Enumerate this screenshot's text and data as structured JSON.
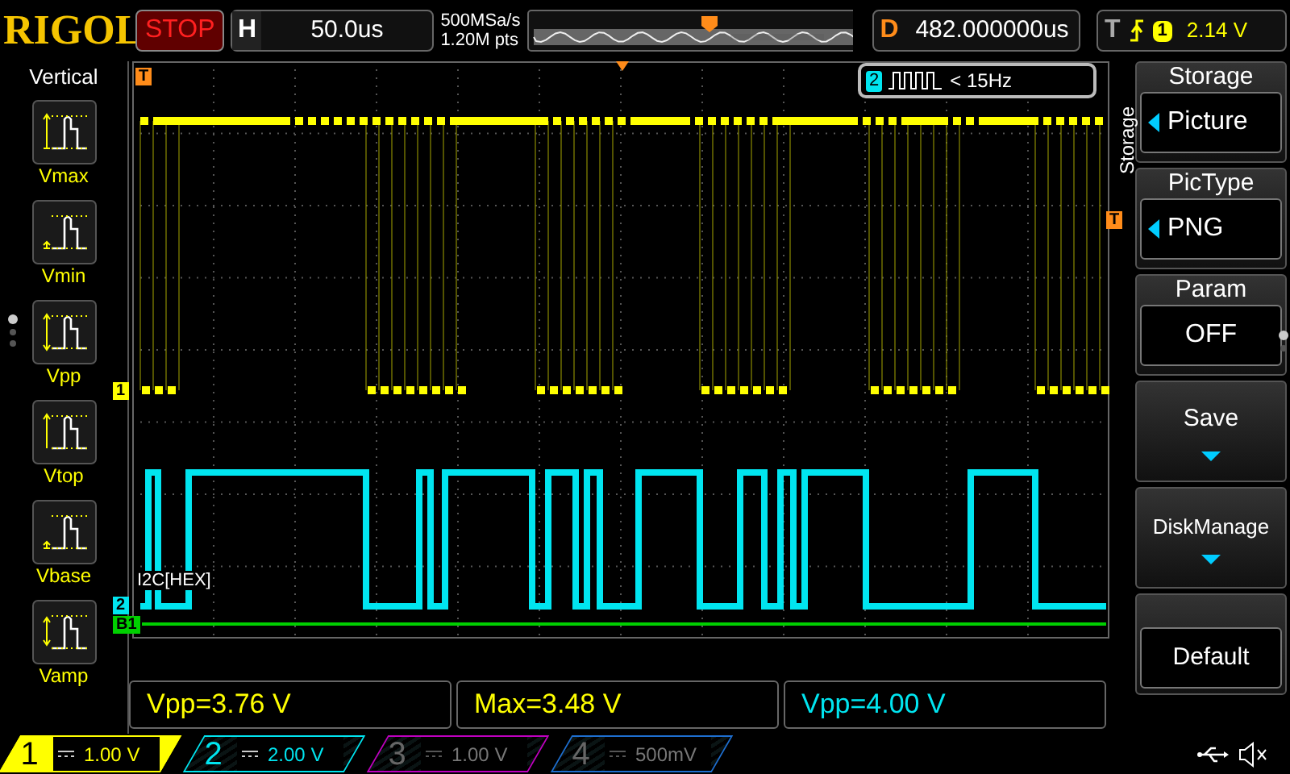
{
  "header": {
    "brand": "RIGOL",
    "run_state": "STOP",
    "horizontal": {
      "label": "H",
      "value": "50.0us"
    },
    "sample_rate": "500MSa/s",
    "memory_depth": "1.20M pts",
    "delay": {
      "label": "D",
      "value": "482.000000us"
    },
    "trigger": {
      "label": "T",
      "source": "1",
      "level": "2.14 V"
    }
  },
  "left_panel": {
    "title": "Vertical",
    "items": [
      {
        "label": "Vmax"
      },
      {
        "label": "Vmin"
      },
      {
        "label": "Vpp"
      },
      {
        "label": "Vtop"
      },
      {
        "label": "Vbase"
      },
      {
        "label": "Vamp"
      }
    ],
    "pages": [
      {
        "selected": true
      },
      {
        "selected": false
      },
      {
        "selected": false
      }
    ]
  },
  "screen": {
    "counter": {
      "channel": "2",
      "reading": "< 15Hz"
    },
    "trigger_marker": "T",
    "trigger_level_marker": "T",
    "channel_markers": [
      {
        "label": "1",
        "color": "#ffff00"
      },
      {
        "label": "2",
        "color": "#00e5f0"
      },
      {
        "label": "B1",
        "color": "#00d000"
      }
    ],
    "bus_label": "I2C[HEX]"
  },
  "right_menu": {
    "title": "Storage",
    "items": [
      {
        "kind": "select",
        "title": "Storage",
        "value": "Picture"
      },
      {
        "kind": "select",
        "title": "PicType",
        "value": "PNG"
      },
      {
        "kind": "value",
        "title": "Param",
        "value": "OFF"
      },
      {
        "kind": "submenu",
        "label": "Save"
      },
      {
        "kind": "submenu",
        "label": "DiskManage"
      },
      {
        "kind": "action",
        "label": "Default"
      }
    ],
    "pages": [
      {
        "selected": true
      },
      {
        "selected": false
      }
    ]
  },
  "measurements": [
    {
      "text": "Vpp=3.76 V",
      "color": "#ffff00"
    },
    {
      "text": "Max=3.48 V",
      "color": "#ffff00"
    },
    {
      "text": "Vpp=4.00 V",
      "color": "#00e5f0"
    }
  ],
  "channels": [
    {
      "number": "1",
      "scale": "1.00 V",
      "color": "#ffff00",
      "on": true,
      "selected": true
    },
    {
      "number": "2",
      "scale": "2.00 V",
      "color": "#00e5f0",
      "on": true,
      "selected": false
    },
    {
      "number": "3",
      "scale": "1.00 V",
      "color": "#c000c0",
      "on": false,
      "selected": false
    },
    {
      "number": "4",
      "scale": "500mV",
      "color": "#1e6fd0",
      "on": false,
      "selected": false
    }
  ]
}
